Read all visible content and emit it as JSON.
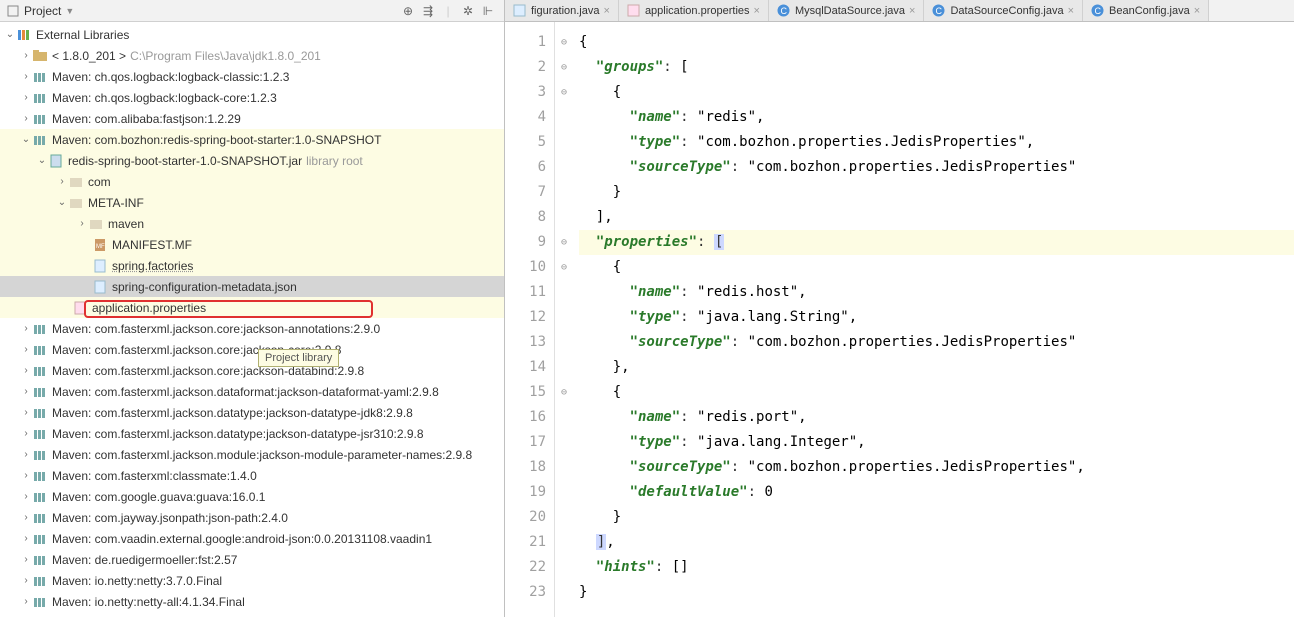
{
  "toolbar": {
    "project_label": "Project"
  },
  "tree": {
    "ext_lib": "External Libraries",
    "jdk": {
      "name": "< 1.8.0_201 >",
      "path": "C:\\Program Files\\Java\\jdk1.8.0_201"
    },
    "items": [
      "Maven: ch.qos.logback:logback-classic:1.2.3",
      "Maven: ch.qos.logback:logback-core:1.2.3",
      "Maven: com.alibaba:fastjson:1.2.29",
      "Maven: com.bozhon:redis-spring-boot-starter:1.0-SNAPSHOT"
    ],
    "jar": {
      "name": "redis-spring-boot-starter-1.0-SNAPSHOT.jar",
      "suffix": "library root"
    },
    "pkg_com": "com",
    "pkg_meta": "META-INF",
    "pkg_maven": "maven",
    "manifest": "MANIFEST.MF",
    "spring_factories": "spring.factories",
    "metadata_json": "spring-configuration-metadata.json",
    "app_props": "application.properties",
    "rest": [
      "Maven: com.fasterxml.jackson.core:jackson-annotations:2.9.0",
      "Maven: com.fasterxml.jackson.core:jackson-core:2.9.8",
      "Maven: com.fasterxml.jackson.core:jackson-databind:2.9.8",
      "Maven: com.fasterxml.jackson.dataformat:jackson-dataformat-yaml:2.9.8",
      "Maven: com.fasterxml.jackson.datatype:jackson-datatype-jdk8:2.9.8",
      "Maven: com.fasterxml.jackson.datatype:jackson-datatype-jsr310:2.9.8",
      "Maven: com.fasterxml.jackson.module:jackson-module-parameter-names:2.9.8",
      "Maven: com.fasterxml:classmate:1.4.0",
      "Maven: com.google.guava:guava:16.0.1",
      "Maven: com.jayway.jsonpath:json-path:2.4.0",
      "Maven: com.vaadin.external.google:android-json:0.0.20131108.vaadin1",
      "Maven: de.ruedigermoeller:fst:2.57",
      "Maven: io.netty:netty:3.7.0.Final",
      "Maven: io.netty:netty-all:4.1.34.Final"
    ]
  },
  "tooltip": "Project library",
  "tabs": [
    {
      "label": "figuration.java",
      "icon": "java"
    },
    {
      "label": "application.properties",
      "icon": "props"
    },
    {
      "label": "MysqlDataSource.java",
      "icon": "class"
    },
    {
      "label": "DataSourceConfig.java",
      "icon": "class"
    },
    {
      "label": "BeanConfig.java",
      "icon": "class"
    }
  ],
  "code": {
    "lines": [
      {
        "n": 1,
        "t": "{"
      },
      {
        "n": 2,
        "t": "  \"groups\": ["
      },
      {
        "n": 3,
        "t": "    {"
      },
      {
        "n": 4,
        "t": "      \"name\": \"redis\","
      },
      {
        "n": 5,
        "t": "      \"type\": \"com.bozhon.properties.JedisProperties\","
      },
      {
        "n": 6,
        "t": "      \"sourceType\": \"com.bozhon.properties.JedisProperties\""
      },
      {
        "n": 7,
        "t": "    }"
      },
      {
        "n": 8,
        "t": "  ],"
      },
      {
        "n": 9,
        "t": "  \"properties\": [",
        "hl": true,
        "caret_after": true
      },
      {
        "n": 10,
        "t": "    {"
      },
      {
        "n": 11,
        "t": "      \"name\": \"redis.host\","
      },
      {
        "n": 12,
        "t": "      \"type\": \"java.lang.String\","
      },
      {
        "n": 13,
        "t": "      \"sourceType\": \"com.bozhon.properties.JedisProperties\""
      },
      {
        "n": 14,
        "t": "    },"
      },
      {
        "n": 15,
        "t": "    {"
      },
      {
        "n": 16,
        "t": "      \"name\": \"redis.port\","
      },
      {
        "n": 17,
        "t": "      \"type\": \"java.lang.Integer\","
      },
      {
        "n": 18,
        "t": "      \"sourceType\": \"com.bozhon.properties.JedisProperties\","
      },
      {
        "n": 19,
        "t": "      \"defaultValue\": 0"
      },
      {
        "n": 20,
        "t": "    }"
      },
      {
        "n": 21,
        "t": "  ],",
        "match_close": true
      },
      {
        "n": 22,
        "t": "  \"hints\": []"
      },
      {
        "n": 23,
        "t": "}"
      }
    ]
  }
}
